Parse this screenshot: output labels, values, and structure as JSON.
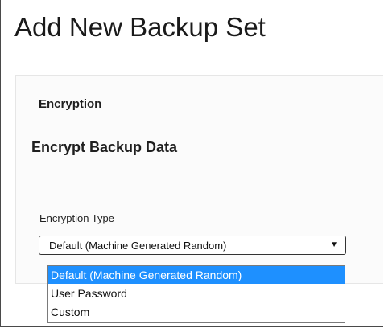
{
  "page": {
    "title": "Add New Backup Set"
  },
  "panel": {
    "heading": "Encryption",
    "section_title": "Encrypt Backup Data",
    "encryption_type": {
      "label": "Encryption Type",
      "selected_value": "Default (Machine Generated Random)",
      "arrow_icon": "dropdown-arrow-icon",
      "options": [
        "Default (Machine Generated Random)",
        "User Password",
        "Custom"
      ],
      "highlighted_index": 0
    }
  },
  "colors": {
    "highlight": "#1e90ff",
    "border": "#333333"
  }
}
